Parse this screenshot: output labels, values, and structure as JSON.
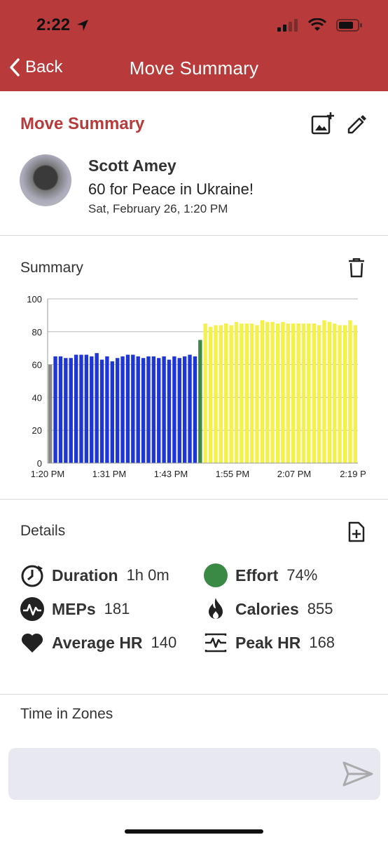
{
  "status_bar": {
    "time": "2:22"
  },
  "nav": {
    "back_label": "Back",
    "title": "Move Summary"
  },
  "header": {
    "title": "Move Summary",
    "user_name": "Scott Amey",
    "move_name": "60 for Peace in Ukraine!",
    "move_date": "Sat, February 26, 1:20 PM"
  },
  "summary": {
    "label": "Summary"
  },
  "chart_data": {
    "type": "bar",
    "ylim": [
      0,
      100
    ],
    "yticks": [
      "0",
      "20",
      "40",
      "60",
      "80",
      "100"
    ],
    "xticks": [
      "1:20 PM",
      "1:31 PM",
      "1:43 PM",
      "1:55 PM",
      "2:07 PM",
      "2:19 P"
    ],
    "grid": true,
    "colors": {
      "blue": "#1f36d6",
      "green": "#3a8a45",
      "yellow": "#f4f24a",
      "gray": "#888888"
    },
    "values": [
      60,
      65,
      65,
      64,
      64,
      66,
      66,
      66,
      65,
      67,
      63,
      65,
      62,
      64,
      65,
      66,
      66,
      65,
      64,
      65,
      65,
      64,
      65,
      63,
      65,
      64,
      65,
      66,
      65,
      75,
      85,
      83,
      84,
      84,
      85,
      84,
      86,
      85,
      85,
      85,
      84,
      87,
      86,
      86,
      85,
      86,
      85,
      85,
      85,
      85,
      85,
      85,
      84,
      87,
      86,
      85,
      84,
      84,
      87,
      84
    ],
    "bar_colors": [
      "gray",
      "blue",
      "blue",
      "blue",
      "blue",
      "blue",
      "blue",
      "blue",
      "blue",
      "blue",
      "blue",
      "blue",
      "blue",
      "blue",
      "blue",
      "blue",
      "blue",
      "blue",
      "blue",
      "blue",
      "blue",
      "blue",
      "blue",
      "blue",
      "blue",
      "blue",
      "blue",
      "blue",
      "blue",
      "green",
      "yellow",
      "yellow",
      "yellow",
      "yellow",
      "yellow",
      "yellow",
      "yellow",
      "yellow",
      "yellow",
      "yellow",
      "yellow",
      "yellow",
      "yellow",
      "yellow",
      "yellow",
      "yellow",
      "yellow",
      "yellow",
      "yellow",
      "yellow",
      "yellow",
      "yellow",
      "yellow",
      "yellow",
      "yellow",
      "yellow",
      "yellow",
      "yellow",
      "yellow",
      "yellow"
    ]
  },
  "details": {
    "label": "Details",
    "duration": {
      "key": "Duration",
      "value": "1h 0m"
    },
    "effort": {
      "key": "Effort",
      "value": "74%",
      "color": "#3a8a45"
    },
    "meps": {
      "key": "MEPs",
      "value": "181"
    },
    "calories": {
      "key": "Calories",
      "value": "855"
    },
    "avg_hr": {
      "key": "Average HR",
      "value": "140"
    },
    "peak_hr": {
      "key": "Peak HR",
      "value": "168"
    }
  },
  "zones": {
    "label": "Time in Zones"
  },
  "theme": {
    "brand": "#b83a3a"
  }
}
